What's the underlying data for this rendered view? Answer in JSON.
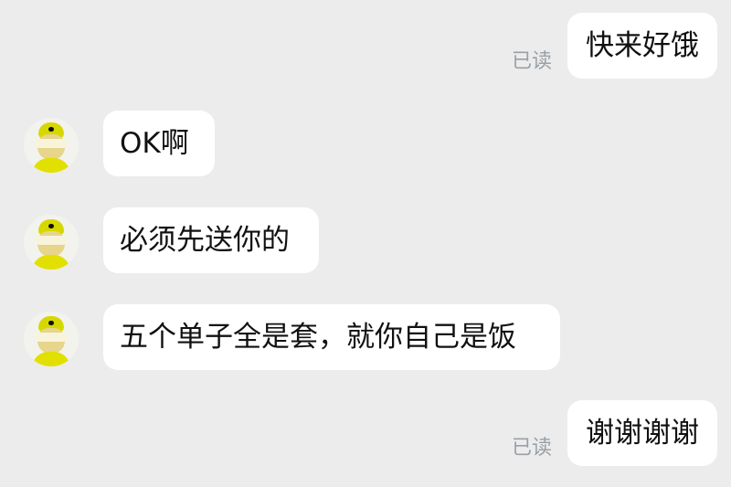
{
  "messages": [
    {
      "side": "outgoing",
      "text": "快来好饿",
      "status": "已读"
    },
    {
      "side": "incoming",
      "avatar": "delivery-rider-avatar",
      "text": "OK啊"
    },
    {
      "side": "incoming",
      "avatar": "delivery-rider-avatar",
      "text": "必须先送你的"
    },
    {
      "side": "incoming",
      "avatar": "delivery-rider-avatar",
      "text": "五个单子全是套，就你自己是饭"
    },
    {
      "side": "outgoing",
      "text": "谢谢谢谢",
      "status": "已读"
    }
  ],
  "colors": {
    "background": "#ececec",
    "bubble": "#ffffff",
    "text": "#111111",
    "read_status": "#9aa0a6",
    "avatar_yellow": "#e1e000"
  }
}
